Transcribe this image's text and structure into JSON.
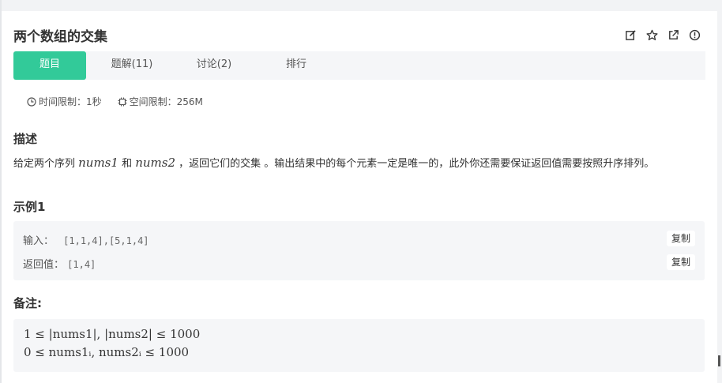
{
  "problem": {
    "title": "两个数组的交集"
  },
  "toolbar": {
    "icons": [
      "edit-icon",
      "star-icon",
      "external-link-icon",
      "info-icon"
    ]
  },
  "tabs": [
    {
      "label": "题目",
      "active": true
    },
    {
      "label": "题解(11)",
      "active": false
    },
    {
      "label": "讨论(2)",
      "active": false
    },
    {
      "label": "排行",
      "active": false
    }
  ],
  "limits": {
    "time": "时间限制：1秒",
    "space": "空间限制：256M"
  },
  "description": {
    "heading": "描述",
    "text_a": "给定两个序列 ",
    "var1": "nums1",
    "text_b": " 和 ",
    "var2": "nums2",
    "text_c": " ，返回它们的交集 。输出结果中的每个元素一定是唯一的，此外你还需要保证返回值需要按照升序排列。"
  },
  "example": {
    "heading": "示例1",
    "input_label": "输入：",
    "input_value": "[1,1,4],[5,1,4]",
    "output_label": "返回值：",
    "output_value": "[1,4]",
    "copy_label": "复制"
  },
  "notes": {
    "heading": "备注:",
    "line1": "1 ≤ |nums1|, |nums2| ≤ 1000",
    "line2": "0 ≤ nums1ᵢ, nums2ᵢ ≤ 1000"
  },
  "colors": {
    "accent": "#32ca99",
    "box_bg": "#f5f6f8"
  }
}
